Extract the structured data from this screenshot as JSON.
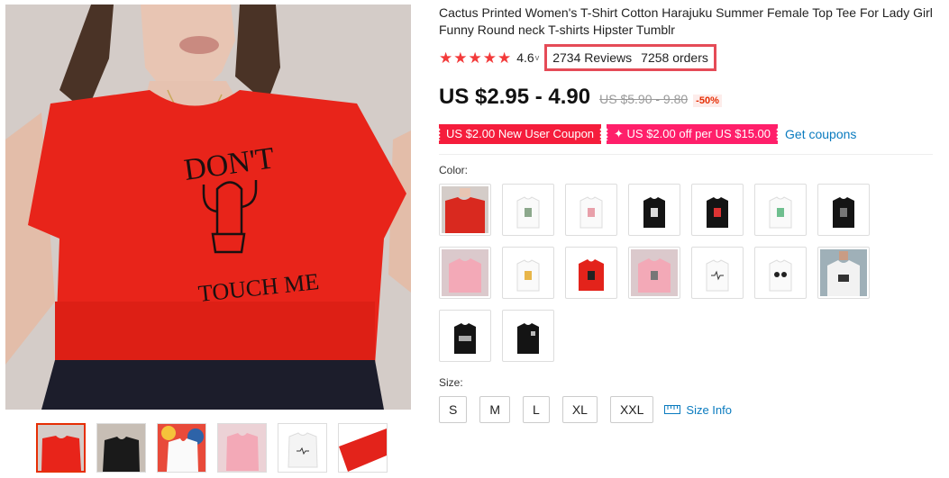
{
  "product": {
    "title": "Cactus Printed Women's T-Shirt Cotton Harajuku Summer Female Top Tee For Lady Girl Funny Round neck T-shirts Hipster Tumblr",
    "rating": "4.6",
    "rating_caret": "v",
    "reviews": "2734 Reviews",
    "orders": "7258 orders",
    "price": "US $2.95 - 4.90",
    "old_price": "US $5.90 - 9.80",
    "discount": "-50%"
  },
  "shirt_print": {
    "line1": "DON'T",
    "line2": "TOUCH ME"
  },
  "coupons": {
    "new_user": "US $2.00 New User Coupon",
    "off": "✦ US $2.00 off per US $15.00",
    "get": "Get coupons"
  },
  "color_label": "Color:",
  "size_label": "Size:",
  "sizes": [
    "S",
    "M",
    "L",
    "XL",
    "XXL"
  ],
  "size_info": "Size Info",
  "colors": {
    "accent_red": "#e62e04",
    "highlight_box": "#e54b57",
    "coupon_red": "#f51d3c",
    "coupon_pink": "#ff1f6a",
    "link_blue": "#0a7bbf",
    "star_red": "#f33a3a"
  },
  "icons": {
    "star": "star-icon",
    "size_info": "ruler-icon"
  }
}
